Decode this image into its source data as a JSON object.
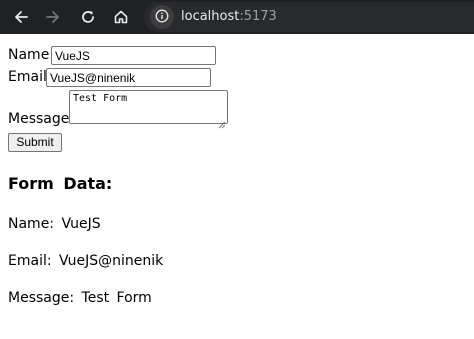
{
  "browser": {
    "url_host": "localhost",
    "url_port": ":5173"
  },
  "form": {
    "name_label": "Name:",
    "name_value": "VueJS",
    "email_label": "Email:",
    "email_value": "VueJS@ninenik",
    "message_label": "Message:",
    "message_value": "Test Form",
    "submit_label": "Submit"
  },
  "form_data": {
    "title": "Form Data:",
    "name_line": "Name: VueJS",
    "email_line": "Email: VueJS@ninenik",
    "message_line": "Message: Test Form"
  },
  "icons": {
    "back": "arrow-left-icon",
    "forward": "arrow-right-icon",
    "reload": "reload-icon",
    "home": "home-icon",
    "site_info": "info-icon"
  }
}
